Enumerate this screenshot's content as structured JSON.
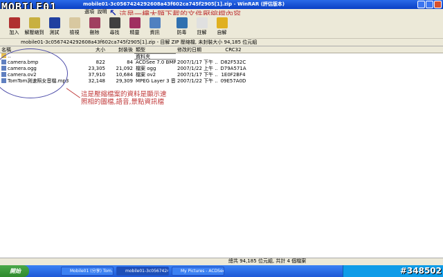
{
  "window": {
    "title": "mobile01-3c0567424292608a43f602ca745f2905[1].zip - WinRAR (評估版本)",
    "logo": "MOBILE01"
  },
  "menu": {
    "items": [
      "檔案",
      "命令",
      "工具",
      "收藏",
      "選項",
      "說明"
    ]
  },
  "annotations": {
    "top": "這是一樓大題下載的文件壓縮檔內容",
    "middle_line1": "這是壓縮檔案的資料是顯示速",
    "middle_line2": "照相的圖檔,語音,景點資訊檔"
  },
  "toolbar": [
    {
      "label": "加入",
      "icon": "add-icon",
      "color": "#b03030"
    },
    {
      "label": "解壓縮到",
      "icon": "extract-icon",
      "color": "#c8b040"
    },
    {
      "label": "測試",
      "icon": "test-icon",
      "color": "#2040a0"
    },
    {
      "label": "檢視",
      "icon": "view-icon",
      "color": "#d8c8a0"
    },
    {
      "label": "刪除",
      "icon": "delete-icon",
      "color": "#a04060"
    },
    {
      "label": "尋找",
      "icon": "find-icon",
      "color": "#404040"
    },
    {
      "label": "精靈",
      "icon": "wizard-icon",
      "color": "#a03060"
    },
    {
      "label": "資訊",
      "icon": "info-icon",
      "color": "#5080c0"
    },
    {
      "label": "防毒",
      "icon": "virus-icon",
      "color": "#3070b0"
    },
    {
      "label": "註解",
      "icon": "comment-icon",
      "color": "#e0e0e0"
    },
    {
      "label": "自解",
      "icon": "sfx-icon",
      "color": "#e0b020"
    }
  ],
  "address": "mobile01-3c0567424292608a43f602ca745f2905[1].zip - 目解 ZIP 壓縮檔, 未封裝大小 94,185 位元組",
  "columns": [
    "名稱",
    "大小",
    "封裝後",
    "類型",
    "修改的日期",
    "CRC32"
  ],
  "rows": [
    {
      "name": "..",
      "size": "",
      "packed": "",
      "type": "資料夾",
      "date": "",
      "crc": ""
    },
    {
      "name": "camera.bmp",
      "size": "822",
      "packed": "84",
      "type": "ACDSee 7.0 BMP ...",
      "date": "2007/1/17 下午 ...",
      "crc": "D82F532C"
    },
    {
      "name": "camera.ogg",
      "size": "23,305",
      "packed": "21,092",
      "type": "檔案 ogg",
      "date": "2007/1/22 上午 ...",
      "crc": "D79A571A"
    },
    {
      "name": "camera.ov2",
      "size": "37,910",
      "packed": "10,684",
      "type": "檔案 ov2",
      "date": "2007/1/17 下午 ...",
      "crc": "1E0F2BF4"
    },
    {
      "name": "TomTom測速照女音檔.mp3",
      "size": "32,148",
      "packed": "29,309",
      "type": "MPEG Layer 3 音訊",
      "date": "2007/1/22 下午 ...",
      "crc": "09E57A0D"
    }
  ],
  "status": {
    "left": "",
    "right": "總共 94,185 位元組, 共計 4 個檔案"
  },
  "taskbar": {
    "start": "開始",
    "tasks": [
      "Mobile01 (分享) Tom...",
      "mobile01-3c0567424...",
      "My Pictures - ACDSee..."
    ],
    "badge": "#348502"
  }
}
